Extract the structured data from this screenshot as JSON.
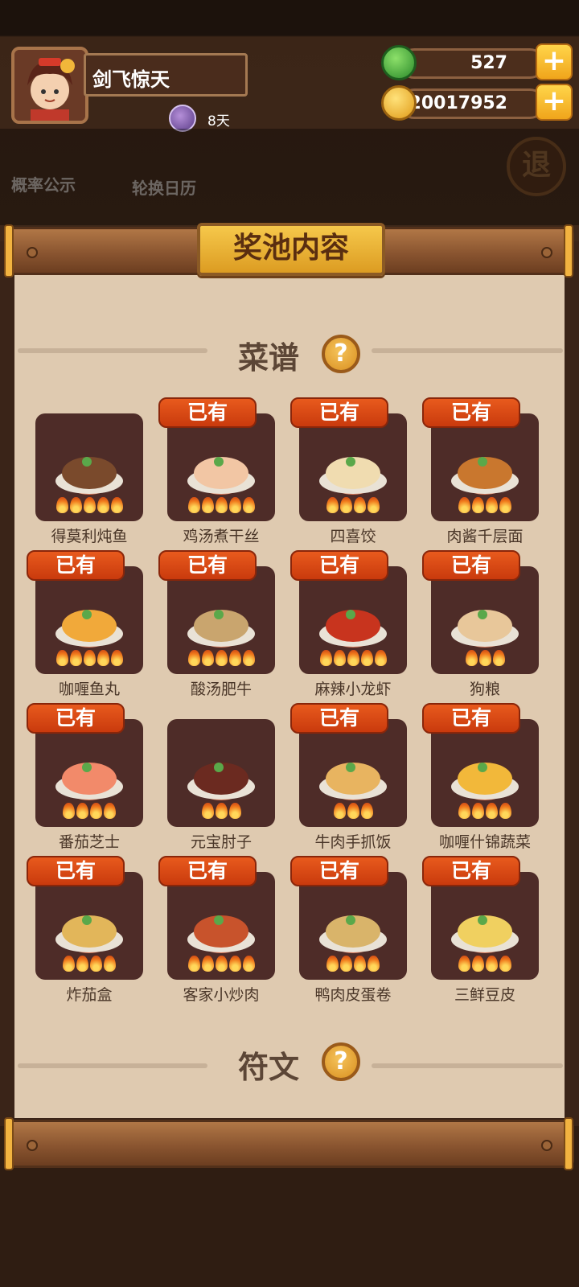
{
  "player": {
    "name": "剑飞惊天",
    "vip_days": "8天"
  },
  "resources": [
    {
      "icon": "green-gem-icon",
      "value": "527",
      "color": "#3aa53a"
    },
    {
      "icon": "gold-coin-icon",
      "value": "20017952",
      "color": "#f0b323"
    }
  ],
  "background_buttons": {
    "probability": "概率公示",
    "calendar": "轮换日历",
    "quit": "退"
  },
  "modal": {
    "title": "奖池内容",
    "recipes_section": "菜谱",
    "runes_section": "符文",
    "help_label": "?",
    "owned_label": "已有"
  },
  "recipes": [
    {
      "name": "得莫利炖鱼",
      "owned": false,
      "flames": 5,
      "dish_color": "#7a4a2c"
    },
    {
      "name": "鸡汤煮干丝",
      "owned": true,
      "flames": 5,
      "dish_color": "#f2c6a4"
    },
    {
      "name": "四喜饺",
      "owned": true,
      "flames": 4,
      "dish_color": "#f0dcb0"
    },
    {
      "name": "肉酱千层面",
      "owned": true,
      "flames": 4,
      "dish_color": "#c9772e"
    },
    {
      "name": "咖喱鱼丸",
      "owned": true,
      "flames": 5,
      "dish_color": "#f1a93a"
    },
    {
      "name": "酸汤肥牛",
      "owned": true,
      "flames": 5,
      "dish_color": "#c9a56e"
    },
    {
      "name": "麻辣小龙虾",
      "owned": true,
      "flames": 5,
      "dish_color": "#c8341e"
    },
    {
      "name": "狗粮",
      "owned": true,
      "flames": 3,
      "dish_color": "#e8c79a"
    },
    {
      "name": "番茄芝士",
      "owned": true,
      "flames": 4,
      "dish_color": "#f28a6a"
    },
    {
      "name": "元宝肘子",
      "owned": false,
      "flames": 3,
      "dish_color": "#6b2a20"
    },
    {
      "name": "牛肉手抓饭",
      "owned": true,
      "flames": 3,
      "dish_color": "#e8b460"
    },
    {
      "name": "咖喱什锦蔬菜",
      "owned": true,
      "flames": 4,
      "dish_color": "#f2b83a"
    },
    {
      "name": "炸茄盒",
      "owned": true,
      "flames": 4,
      "dish_color": "#e2b65a"
    },
    {
      "name": "客家小炒肉",
      "owned": true,
      "flames": 5,
      "dish_color": "#c8532c"
    },
    {
      "name": "鸭肉皮蛋卷",
      "owned": true,
      "flames": 4,
      "dish_color": "#d9b46a"
    },
    {
      "name": "三鲜豆皮",
      "owned": true,
      "flames": 4,
      "dish_color": "#f0d060"
    }
  ]
}
